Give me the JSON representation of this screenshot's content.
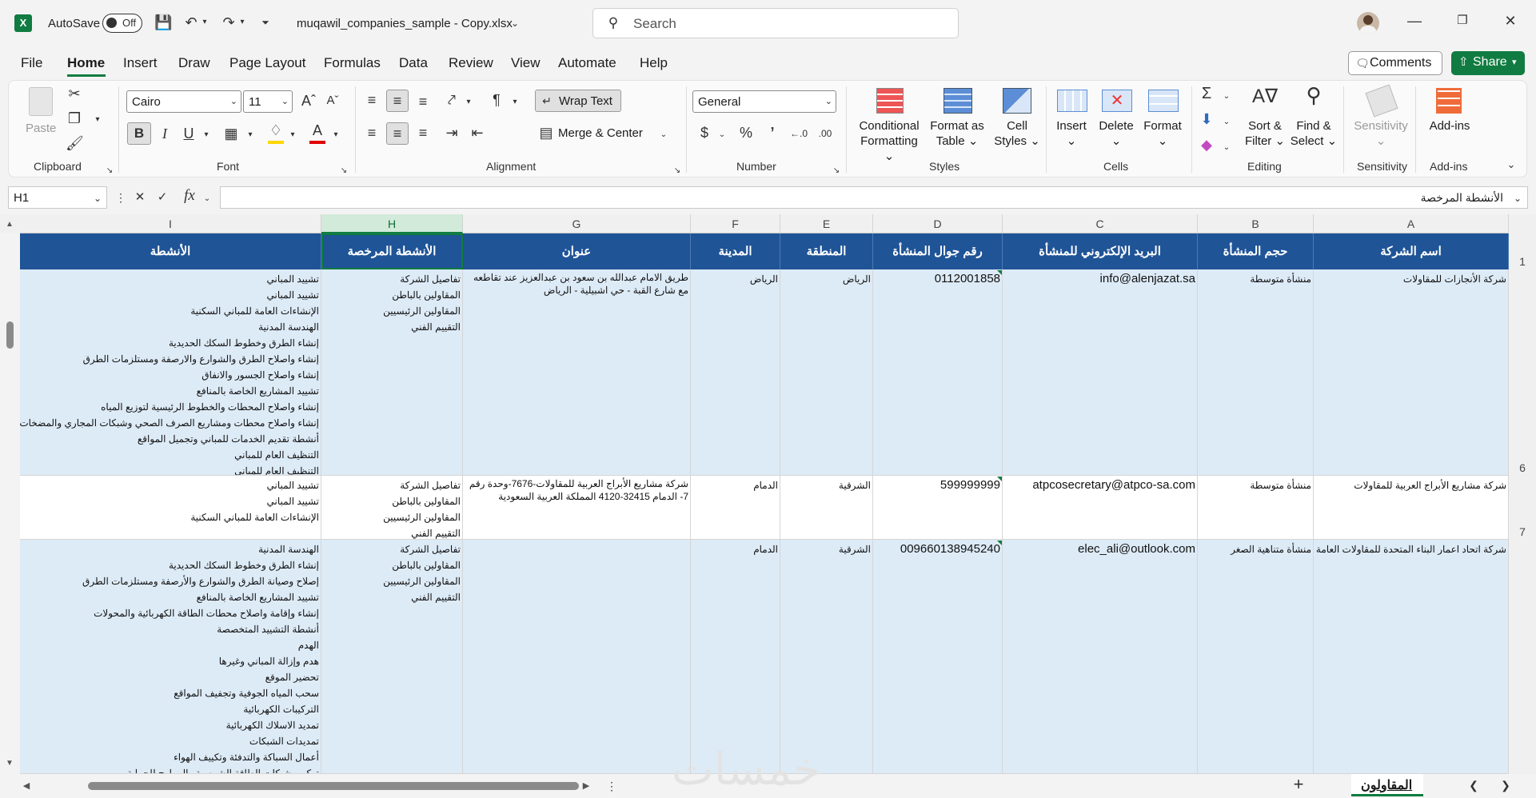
{
  "titlebar": {
    "autosave_label": "AutoSave",
    "autosave_state": "Off",
    "file_name": "muqawil_companies_sample - Copy.xlsx",
    "search_placeholder": "Search"
  },
  "menu": {
    "items": [
      "File",
      "Home",
      "Insert",
      "Draw",
      "Page Layout",
      "Formulas",
      "Data",
      "Review",
      "View",
      "Automate",
      "Help"
    ],
    "active": "Home",
    "comments_label": "Comments",
    "share_label": "Share"
  },
  "ribbon": {
    "clipboard": {
      "paste": "Paste",
      "label": "Clipboard"
    },
    "font": {
      "name": "Cairo",
      "size": "11",
      "label": "Font"
    },
    "alignment": {
      "wrap_text": "Wrap Text",
      "merge_center": "Merge & Center",
      "label": "Alignment"
    },
    "number": {
      "format": "General",
      "label": "Number"
    },
    "styles": {
      "conditional": "Conditional",
      "conditional2": "Formatting",
      "format_as": "Format as",
      "format_as2": "Table",
      "cell": "Cell",
      "cell2": "Styles",
      "label": "Styles"
    },
    "cells": {
      "insert": "Insert",
      "delete": "Delete",
      "format": "Format",
      "label": "Cells"
    },
    "editing": {
      "sort": "Sort &",
      "sort2": "Filter",
      "find": "Find &",
      "find2": "Select",
      "label": "Editing"
    },
    "sensitivity": {
      "btn": "Sensitivity",
      "label": "Sensitivity"
    },
    "addins": {
      "btn": "Add-ins",
      "label": "Add-ins"
    }
  },
  "formula_bar": {
    "name_box": "H1",
    "content": "الأنشطة المرخصة"
  },
  "grid": {
    "columns": [
      "I",
      "H",
      "G",
      "F",
      "E",
      "D",
      "C",
      "B",
      "A"
    ],
    "selected_column": "H",
    "headers": {
      "A": "اسم الشركة",
      "B": "حجم المنشأة",
      "C": "البريد الإلكتروني للمنشأة",
      "D": "رقم جوال المنشأة",
      "E": "المنطقة",
      "F": "المدينة",
      "G": "عنوان",
      "H": "الأنشطة المرخصة",
      "I": "الأنشطة"
    },
    "row_numbers": [
      "1",
      "6",
      "7"
    ],
    "rows": [
      {
        "A": "شركة الأنجازات للمقاولات",
        "B": "منشأة متوسطة",
        "C": "info@alenjazat.sa",
        "D": "0112001858",
        "E": "الرياض",
        "F": "الرياض",
        "G": [
          "طريق الامام عبدالله بن سعود بن عبدالعزيز عند تقاطعه",
          "مع شارع القبة - حي اشبيلية - الرياض"
        ],
        "H": [
          "تفاصيل الشركة",
          "المقاولين بالباطن",
          "المقاولين الرئيسيين",
          "التقييم الفني"
        ],
        "I": [
          "تشييد المباني",
          "تشييد المباني",
          "الإنشاءات العامة للمباني السكنية",
          "الهندسة المدنية",
          "إنشاء الطرق وخطوط السكك الحديدية",
          "إنشاء واصلاح الطرق  والشوارع والارصفة ومستلزمات الطرق",
          "إنشاء واصلاح الجسور والانفاق",
          "تشييد المشاريع الخاصة بالمنافع",
          "إنشاء واصلاح المحطات والخطوط الرئيسية لتوزيع المياه",
          "إنشاء واصلاح محطات ومشاريع الصرف الصحي وشبكات المجاري والمضخات",
          "أنشطة تقديم الخدمات للمباني وتجميل المواقع",
          "التنظيف العام للمباني",
          "التنظيف العام للمباني"
        ]
      },
      {
        "A": "شركة مشاريع الأبراج العربية للمقاولات",
        "B": "منشأة متوسطة",
        "C": "atpcosecretary@atpco-sa.com",
        "D": "599999999",
        "E": "الشرقية",
        "F": "الدمام",
        "G": [
          "شركة مشاريع الأبراج العربية للمقاولات-7676-وحدة رقم",
          "7- الدمام 32415-4120 المملكة العربية السعودية"
        ],
        "H": [
          "تفاصيل الشركة",
          "المقاولين بالباطن",
          "المقاولين الرئيسيين",
          "التقييم الفني"
        ],
        "I": [
          "تشييد المباني",
          "تشييد المباني",
          "الإنشاءات العامة للمباني السكنية"
        ]
      },
      {
        "A": "شركة اتحاد اعمار البناء المتحدة للمقاولات العامة",
        "B": "منشأة متناهية الصغر",
        "C": "elec_ali@outlook.com",
        "D": "009660138945240",
        "E": "الشرقية",
        "F": "الدمام",
        "G": [],
        "H": [
          "تفاصيل الشركة",
          "المقاولين بالباطن",
          "المقاولين الرئيسيين",
          "التقييم الفني"
        ],
        "I": [
          "الهندسة المدنية",
          "إنشاء الطرق وخطوط السكك الحديدية",
          "إصلاح وصيانة الطرق والشوارع والأرصفة ومستلزمات الطرق",
          "تشييد المشاريع الخاصة بالمنافع",
          "إنشاء وإقامة واصلاح محطات الطاقة الكهربائية والمحولات",
          "أنشطة التشييد المتخصصة",
          "الهدم",
          "هدم وإزالة المباني وغيرها",
          "تحضير الموقع",
          "سحب المياه الجوفية وتجفيف المواقع",
          "التركيبات الكهربائية",
          "تمديد الاسلاك الكهربائية",
          "تمديدات  الشبكات",
          "أعمال السباكة والتدفئة وتكييف الهواء",
          "تركيب شبكات الطاقة الشمسية والمراوح للحماية"
        ]
      }
    ]
  },
  "sheets": {
    "tabs": [
      "المقاولون"
    ],
    "active": "المقاولون",
    "watermark": "خمسات"
  },
  "colors": {
    "header_blue": "#1f5497",
    "row_band": "#ddebf7",
    "excel_green": "#107c41"
  }
}
